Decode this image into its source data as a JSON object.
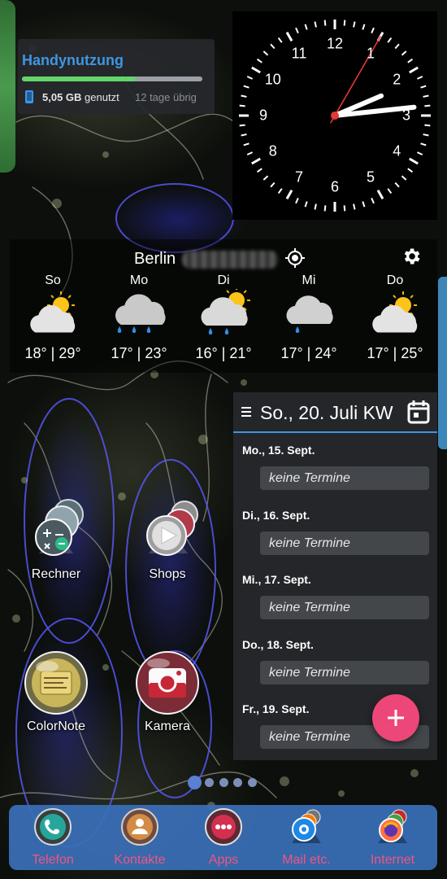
{
  "usage_widget": {
    "title": "Handynutzung",
    "used": "5,05 GB",
    "used_suffix": "genutzt",
    "remaining": "12 tage übrig",
    "used_fraction": 0.63,
    "accent": "#3f96e2",
    "bar_color": "#64d56a"
  },
  "clock": {
    "numbers": [
      "12",
      "1",
      "2",
      "3",
      "4",
      "5",
      "6",
      "7",
      "8",
      "9",
      "10",
      "11"
    ],
    "time": {
      "hour": 2,
      "minute": 14,
      "second": 5
    },
    "second_hand_color": "#e53935"
  },
  "weather": {
    "city": "Berlin",
    "icons": {
      "locate": "gps-locate-icon",
      "settings": "gear-icon"
    },
    "days": [
      {
        "name": "So",
        "temp": "18° | 29°",
        "condition": "partly-cloudy-icon"
      },
      {
        "name": "Mo",
        "temp": "17° | 23°",
        "condition": "rain-cloud-icon"
      },
      {
        "name": "Di",
        "temp": "16° | 21°",
        "condition": "sun-rain-icon"
      },
      {
        "name": "Mi",
        "temp": "17° | 24°",
        "condition": "light-rain-icon"
      },
      {
        "name": "Do",
        "temp": "17° | 25°",
        "condition": "partly-cloudy-icon"
      }
    ]
  },
  "calendar": {
    "title": "So., 20. Juli KW",
    "icons": {
      "menu": "menu-icon",
      "date": "calendar-icon",
      "add": "plus-icon"
    },
    "entries": [
      {
        "date": "Mo., 15. Sept.",
        "event": "keine Termine"
      },
      {
        "date": "Di., 16. Sept.",
        "event": "keine Termine"
      },
      {
        "date": "Mi., 17. Sept.",
        "event": "keine Termine"
      },
      {
        "date": "Do., 18. Sept.",
        "event": "keine Termine"
      },
      {
        "date": "Fr., 19. Sept.",
        "event": "keine Termine"
      }
    ],
    "fab_color": "#ec4778"
  },
  "apps": [
    {
      "label": "Rechner",
      "icon": "calculator-folder-icon"
    },
    {
      "label": "Shops",
      "icon": "shops-folder-icon"
    },
    {
      "label": "ColorNote",
      "icon": "colornote-icon"
    },
    {
      "label": "Kamera",
      "icon": "camera-icon"
    }
  ],
  "pager": {
    "count": 5,
    "active": 0
  },
  "dock": {
    "items": [
      {
        "label": "Telefon",
        "icon": "phone-icon"
      },
      {
        "label": "Kontakte",
        "icon": "contacts-icon"
      },
      {
        "label": "Apps",
        "icon": "app-drawer-icon"
      },
      {
        "label": "Mail etc.",
        "icon": "mail-folder-icon"
      },
      {
        "label": "Internet",
        "icon": "browser-folder-icon"
      }
    ],
    "label_color": "#f05583",
    "background": "#3a70b8"
  }
}
